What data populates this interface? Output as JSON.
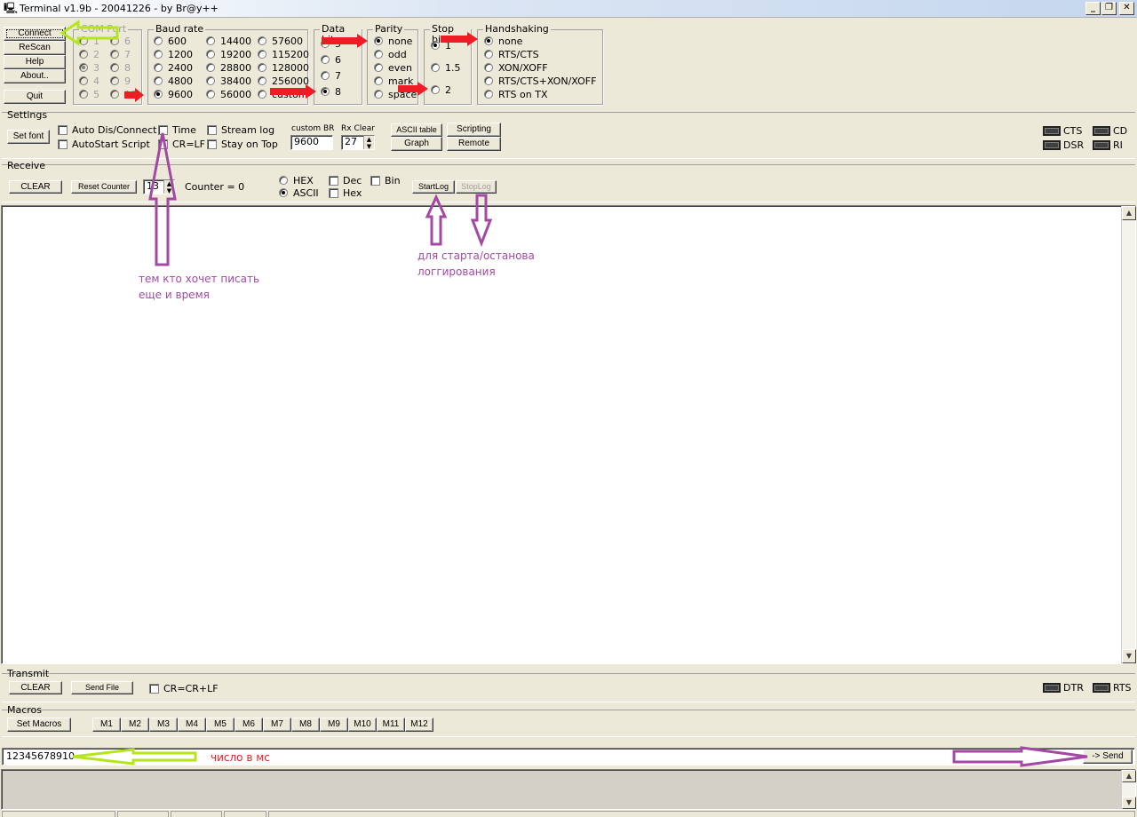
{
  "window": {
    "title": "Terminal v1.9b - 20041226 - by Br@y++",
    "controls": [
      "_",
      "❐",
      "✕"
    ]
  },
  "left_buttons": {
    "connect": "Connect",
    "rescan": "ReScan",
    "help": "Help",
    "about": "About..",
    "quit": "Quit"
  },
  "comport": {
    "caption": "COM Port",
    "options": [
      "1",
      "2",
      "3",
      "4",
      "5",
      "6",
      "7",
      "8",
      "9",
      "10"
    ],
    "selected": "3"
  },
  "baud": {
    "caption": "Baud rate",
    "col1": [
      "600",
      "1200",
      "2400",
      "4800",
      "9600"
    ],
    "col2": [
      "14400",
      "19200",
      "28800",
      "38400",
      "56000"
    ],
    "col3": [
      "57600",
      "115200",
      "128000",
      "256000",
      "custom"
    ],
    "selected": "9600"
  },
  "databits": {
    "caption": "Data bits",
    "options": [
      "5",
      "6",
      "7",
      "8"
    ],
    "selected": "8"
  },
  "parity": {
    "caption": "Parity",
    "options": [
      "none",
      "odd",
      "even",
      "mark",
      "space"
    ],
    "selected": "none"
  },
  "stopbits": {
    "caption": "Stop bits",
    "options": [
      "1",
      "1.5",
      "2"
    ],
    "selected": "1"
  },
  "handshaking": {
    "caption": "Handshaking",
    "options": [
      "none",
      "RTS/CTS",
      "XON/XOFF",
      "RTS/CTS+XON/XOFF",
      "RTS on TX"
    ],
    "selected": "none"
  },
  "settings": {
    "caption": "Settings",
    "set_font": "Set font",
    "auto_dis_connect": "Auto Dis/Connect",
    "autostart_script": "AutoStart Script",
    "time": "Time",
    "crlf": "CR=LF",
    "stream_log": "Stream log",
    "stay_on_top": "Stay on Top",
    "custom_br_label": "custom BR",
    "custom_br_value": "9600",
    "rx_clear_label": "Rx Clear",
    "rx_clear_value": "27",
    "ascii_table": "ASCII table",
    "scripting": "Scripting",
    "graph": "Graph",
    "remote": "Remote",
    "leds": {
      "cts": "CTS",
      "cd": "CD",
      "dsr": "DSR",
      "ri": "RI"
    }
  },
  "receive": {
    "caption": "Receive",
    "clear": "CLEAR",
    "reset_counter": "Reset Counter",
    "counter_spin": "13",
    "counter_label": "Counter = 0",
    "hex": "HEX",
    "ascii": "ASCII",
    "dec": "Dec",
    "hex_check": "Hex",
    "bin": "Bin",
    "start_log": "StartLog",
    "stop_log": "StopLog"
  },
  "transmit": {
    "caption": "Transmit",
    "clear": "CLEAR",
    "send_file": "Send File",
    "cr_crlf": "CR=CR+LF",
    "leds": {
      "dtr": "DTR",
      "rts": "RTS"
    }
  },
  "macros": {
    "caption": "Macros",
    "set_macros": "Set Macros",
    "items": [
      "M1",
      "M2",
      "M3",
      "M4",
      "M5",
      "M6",
      "M7",
      "M8",
      "M9",
      "M10",
      "M11",
      "M12"
    ]
  },
  "send": {
    "input_value": "12345678910",
    "send_button": "-> Send"
  },
  "annotations": {
    "time_note_line1": "тем кто хочет писать",
    "time_note_line2": "еще и время",
    "log_note_line1": "для старта/останова",
    "log_note_line2": "логгирования",
    "input_note": "число в мс"
  },
  "colors": {
    "red_arrow": "#ee1c24",
    "green_arrow": "#b5e61d",
    "purple_arrow": "#a349a4",
    "annotation_purple": "#a349a4",
    "annotation_red": "#ee1c24"
  }
}
